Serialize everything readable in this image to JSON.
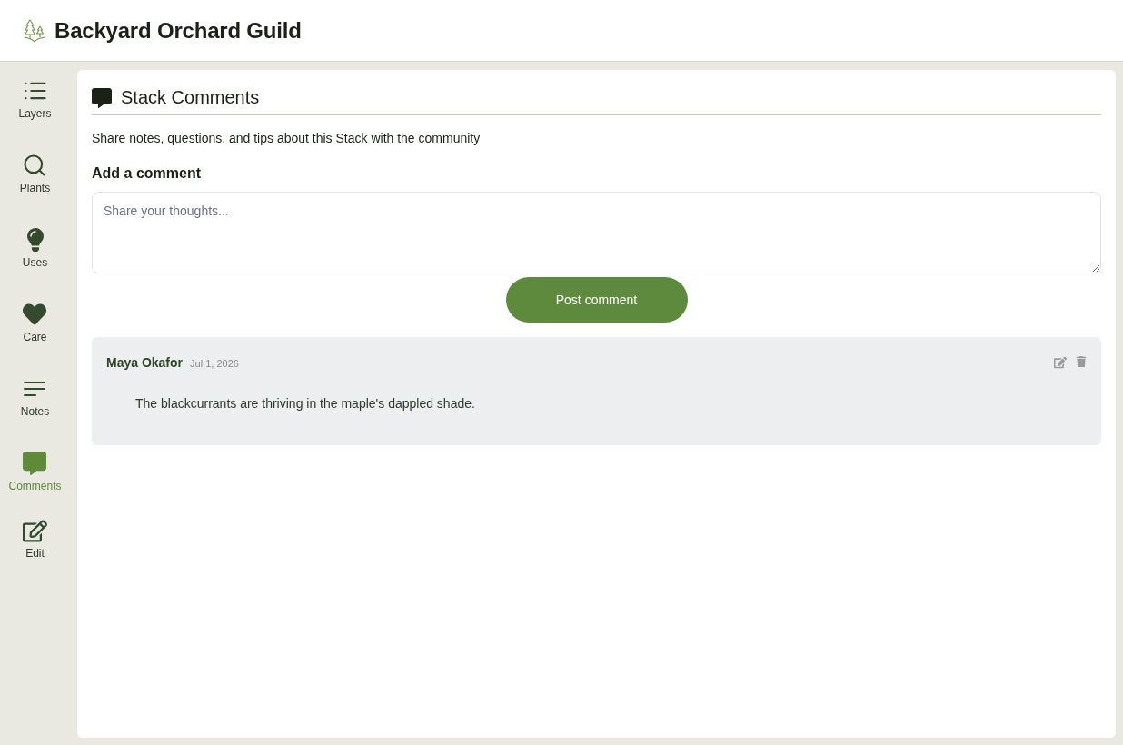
{
  "header": {
    "title": "Backyard Orchard Guild"
  },
  "sidebar": {
    "items": [
      {
        "label": "Layers",
        "selected": false
      },
      {
        "label": "Plants",
        "selected": false
      },
      {
        "label": "Uses",
        "selected": false
      },
      {
        "label": "Care",
        "selected": false
      },
      {
        "label": "Notes",
        "selected": false
      },
      {
        "label": "Comments",
        "selected": true
      },
      {
        "label": "Edit",
        "selected": false
      }
    ]
  },
  "panel": {
    "title": "Stack Comments",
    "description": "Share notes, questions, and tips about this Stack with the community",
    "form": {
      "label": "Add a comment",
      "placeholder": "Share your thoughts...",
      "submit": "Post comment"
    },
    "comments": [
      {
        "author": "Maya Okafor",
        "date": "Jul 1, 2026",
        "text": "The blackcurrants are thriving in the maple's dappled shade."
      }
    ]
  }
}
